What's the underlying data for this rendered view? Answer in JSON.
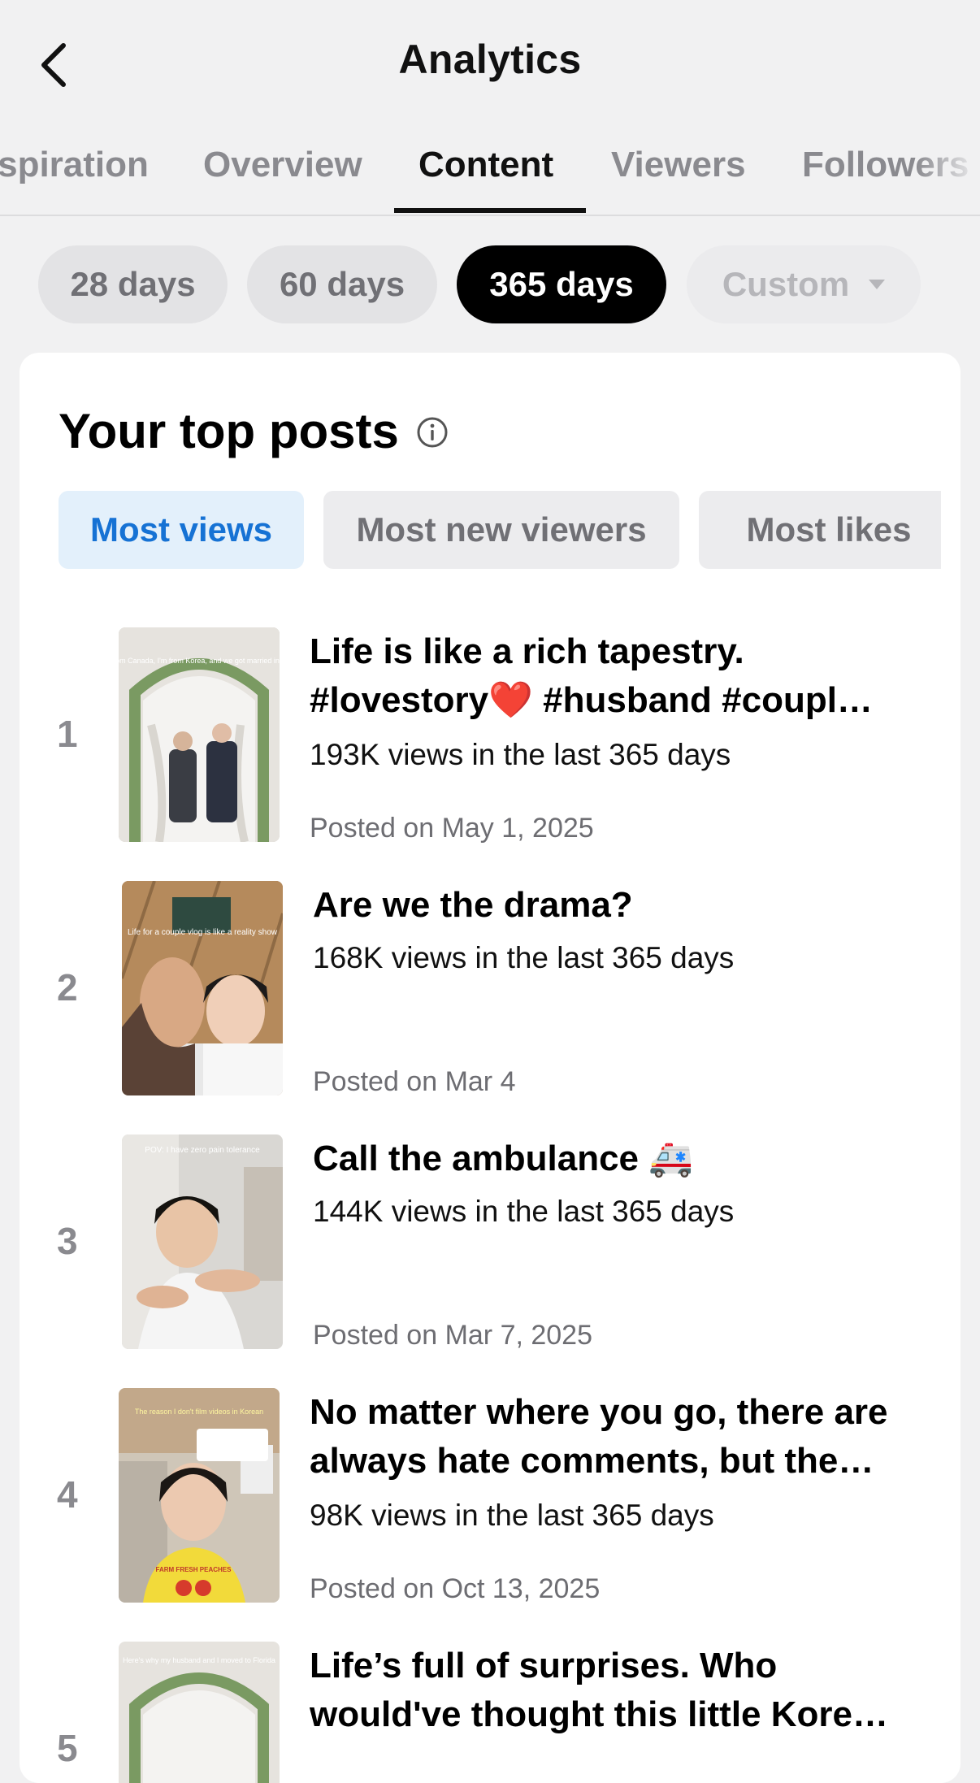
{
  "header": {
    "title": "Analytics",
    "back_icon": "chevron-left-icon"
  },
  "tabs": [
    {
      "label": "Inspiration",
      "active": false
    },
    {
      "label": "Overview",
      "active": false
    },
    {
      "label": "Content",
      "active": true
    },
    {
      "label": "Viewers",
      "active": false
    },
    {
      "label": "Followers",
      "active": false
    }
  ],
  "ranges": [
    {
      "label": "28 days",
      "state": "normal"
    },
    {
      "label": "60 days",
      "state": "normal"
    },
    {
      "label": "365 days",
      "state": "selected"
    },
    {
      "label": "Custom",
      "state": "disabled"
    }
  ],
  "top_posts": {
    "title": "Your top posts",
    "info_icon": "info-circle-icon",
    "filters": [
      {
        "label": "Most views",
        "active": true
      },
      {
        "label": "Most new viewers",
        "active": false
      },
      {
        "label": "Most likes",
        "active": false
      }
    ],
    "posts": [
      {
        "rank": "1",
        "title_line1": "Life is like a rich tapestry.",
        "title_line2": "#lovestory❤️ #husband #coupl…",
        "views": "193K views in the last 365 days",
        "date": "Posted on May 1, 2025",
        "thumb_caption": "He is from Canada, I'm from Korea, and we got married in Florida."
      },
      {
        "rank": "2",
        "title_line1": "Are we the drama?",
        "title_line2": "",
        "views": "168K views in the last 365 days",
        "date": "Posted on Mar 4",
        "thumb_caption": "Life for a couple vlog is like a reality show"
      },
      {
        "rank": "3",
        "title_line1": "Call the ambulance 🚑",
        "title_line2": "",
        "views": "144K views in the last 365 days",
        "date": "Posted on Mar 7, 2025",
        "thumb_caption": "POV: I have zero pain tolerance"
      },
      {
        "rank": "4",
        "title_line1": "No matter where you go, there are",
        "title_line2": "always hate comments, but the…",
        "views": "98K views in the last 365 days",
        "date": "Posted on Oct 13, 2025",
        "thumb_caption": "The reason I don't film videos in Korean",
        "shirt_text": "FARM FRESH PEACHES"
      },
      {
        "rank": "5",
        "title_line1": "Life’s full of surprises. Who",
        "title_line2": "would've thought this little Kore…",
        "views": "",
        "date": "",
        "thumb_caption": "Here's why my husband and I moved to Florida"
      }
    ]
  },
  "colors": {
    "active_filter_text": "#1672d4",
    "active_filter_bg": "#e3f0fb",
    "selected_range_bg": "#000000"
  }
}
